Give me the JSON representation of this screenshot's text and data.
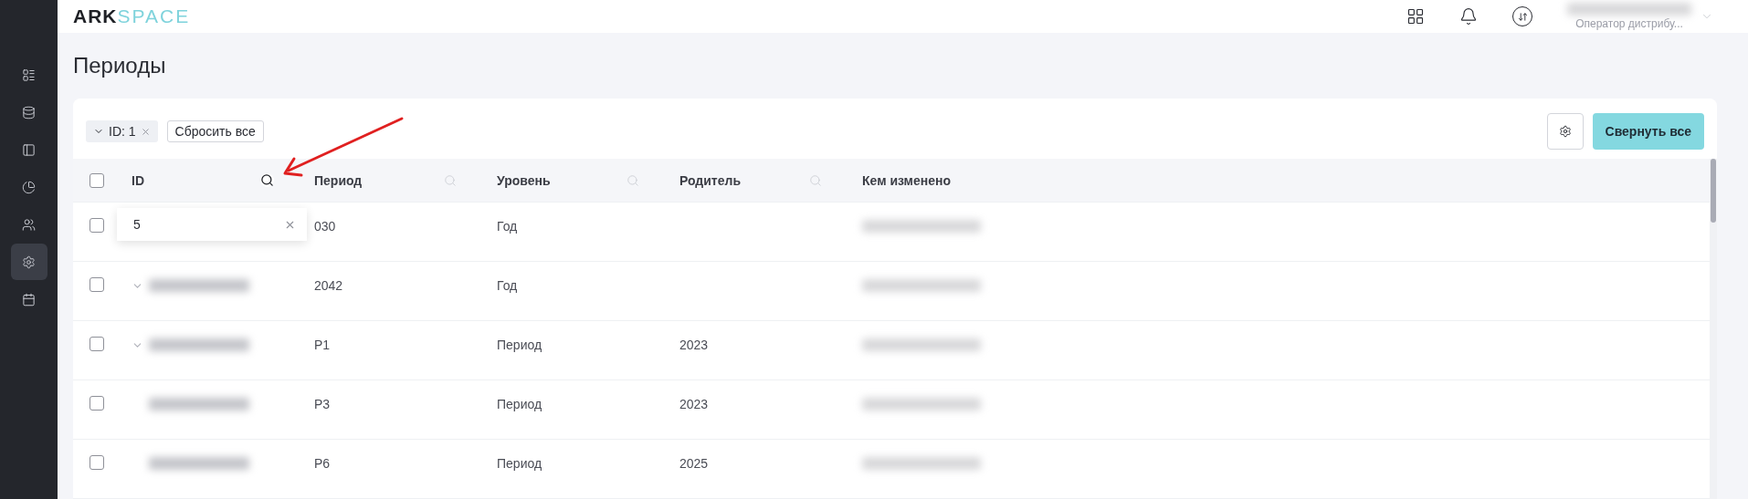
{
  "logo": {
    "strong": "ARK",
    "light": "SPACE"
  },
  "sidebar": {
    "items": [
      {
        "kind": "list",
        "selected": false
      },
      {
        "kind": "database",
        "selected": false
      },
      {
        "kind": "panel",
        "selected": false
      },
      {
        "kind": "chart",
        "selected": false
      },
      {
        "kind": "users",
        "selected": false
      },
      {
        "kind": "settings",
        "selected": true
      },
      {
        "kind": "calendar",
        "selected": false
      }
    ]
  },
  "header": {
    "user_role": "Оператор дистрибу..."
  },
  "page_title": "Периоды",
  "toolbar": {
    "filter_chip": "ID: 1",
    "reset_button": "Сбросить все",
    "collapse_button": "Свернуть все"
  },
  "table": {
    "all_checked": false,
    "columns": [
      {
        "label": "ID",
        "searchable": true,
        "search_active": true
      },
      {
        "label": "Период",
        "searchable": true,
        "search_active": false
      },
      {
        "label": "Уровень",
        "searchable": true,
        "search_active": false
      },
      {
        "label": "Родитель",
        "searchable": true,
        "search_active": false
      },
      {
        "label": "Кем изменено",
        "searchable": false
      }
    ],
    "rows": [
      {
        "checked": false,
        "expandable": false,
        "id_hidden": true,
        "period": "030",
        "level": "Год",
        "parent": ""
      },
      {
        "checked": false,
        "expandable": true,
        "id_hidden": false,
        "period": "2042",
        "level": "Год",
        "parent": ""
      },
      {
        "checked": false,
        "expandable": true,
        "id_hidden": false,
        "period": "P1",
        "level": "Период",
        "parent": "2023"
      },
      {
        "checked": false,
        "expandable": false,
        "id_hidden": false,
        "period": "P3",
        "level": "Период",
        "parent": "2023"
      },
      {
        "checked": false,
        "expandable": false,
        "id_hidden": false,
        "period": "P6",
        "level": "Период",
        "parent": "2025"
      }
    ]
  },
  "search_popup": {
    "value": "5"
  }
}
